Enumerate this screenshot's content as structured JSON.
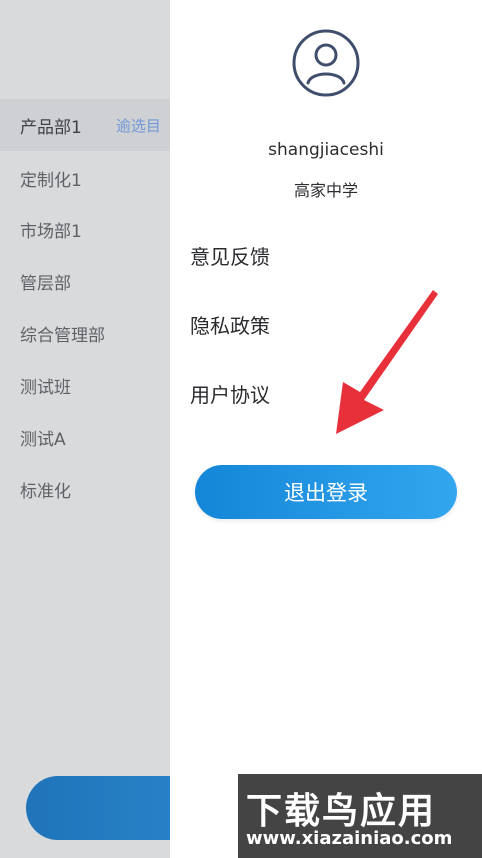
{
  "left_panel": {
    "items": [
      {
        "label": "产品部1",
        "extra": "逾选目"
      },
      {
        "label": "定制化1"
      },
      {
        "label": "市场部1"
      },
      {
        "label": "管层部"
      },
      {
        "label": "综合管理部"
      },
      {
        "label": "测试班"
      },
      {
        "label": "测试A"
      },
      {
        "label": "标准化"
      }
    ]
  },
  "drawer": {
    "username": "shangjiaceshi",
    "school": "高家中学",
    "menu": [
      "意见反馈",
      "隐私政策",
      "用户协议"
    ],
    "logout_label": "退出登录"
  },
  "watermark": {
    "main": "下载鸟应用",
    "url": "www.xiazainiao.com"
  },
  "colors": {
    "accent": "#2196e8",
    "arrow": "#e8303a"
  }
}
